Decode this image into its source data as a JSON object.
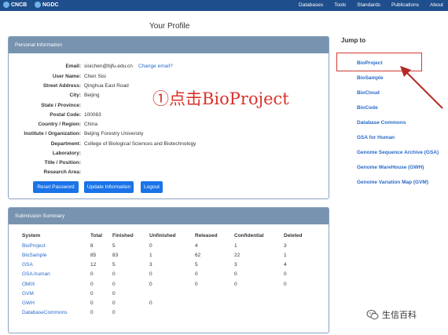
{
  "topbar": {
    "brand_cncb": "CNCB",
    "brand_ngdc": "NGDC",
    "nav": [
      "Databases",
      "Tools",
      "Standards",
      "Publications",
      "About"
    ]
  },
  "page_title": "Your Profile",
  "personal": {
    "heading": "Personal Information",
    "fields": [
      {
        "label": "Email:",
        "value": "sisichen@bjfu.edu.cn"
      },
      {
        "label": "User Name:",
        "value": "Chen Sisi"
      },
      {
        "label": "Street Address:",
        "value": "Qinghua East Road"
      },
      {
        "label": "City:",
        "value": "Beijing"
      },
      {
        "label": "State / Province:",
        "value": ""
      },
      {
        "label": "Postal Code:",
        "value": "100083"
      },
      {
        "label": "Country / Region:",
        "value": "China"
      },
      {
        "label": "Institute / Organization:",
        "value": "Beijing Forestry University"
      },
      {
        "label": "Department:",
        "value": "College of Biological Sciences and Biotechnology"
      },
      {
        "label": "Laboratory:",
        "value": ""
      },
      {
        "label": "Title / Position:",
        "value": ""
      },
      {
        "label": "Research Area:",
        "value": ""
      }
    ],
    "change_email": "Change email?",
    "buttons": {
      "reset": "Reset Password",
      "update": "Update Information",
      "logout": "Logout"
    }
  },
  "annotation": "①点击BioProject",
  "summary": {
    "heading": "Submission Summary",
    "columns": [
      "System",
      "Total",
      "Finished",
      "Unfinished",
      "Released",
      "Confidential",
      "Deleted"
    ],
    "rows": [
      [
        "BioProject",
        "8",
        "5",
        "0",
        "4",
        "1",
        "3"
      ],
      [
        "BioSample",
        "85",
        "83",
        "1",
        "62",
        "22",
        "1"
      ],
      [
        "GSA",
        "12",
        "5",
        "3",
        "5",
        "3",
        "4"
      ],
      [
        "GSA-human",
        "0",
        "0",
        "0",
        "0",
        "0",
        "0"
      ],
      [
        "OMIX",
        "0",
        "0",
        "0",
        "0",
        "0",
        "0"
      ],
      [
        "GVM",
        "0",
        "0",
        "",
        "",
        "",
        ""
      ],
      [
        "GWH",
        "0",
        "0",
        "0",
        "",
        "",
        ""
      ],
      [
        "DatabaseCommons",
        "0",
        "0",
        "",
        "",
        "",
        ""
      ]
    ]
  },
  "jump": {
    "title": "Jump to",
    "links": [
      "BioProject",
      "BioSample",
      "BioCloud",
      "BioCode",
      "Database Commons",
      "GSA for Human",
      "Genome Sequence Archive (GSA)",
      "Genome WareHouse (GWH)",
      "Genome Variation Map (GVM)"
    ]
  },
  "watermark": "生信百科",
  "colors": {
    "header": "#1f4e8c",
    "panel_head": "#7893b0",
    "link": "#2a6ac8",
    "button": "#1a73e8",
    "annotation": "#d9322a"
  }
}
